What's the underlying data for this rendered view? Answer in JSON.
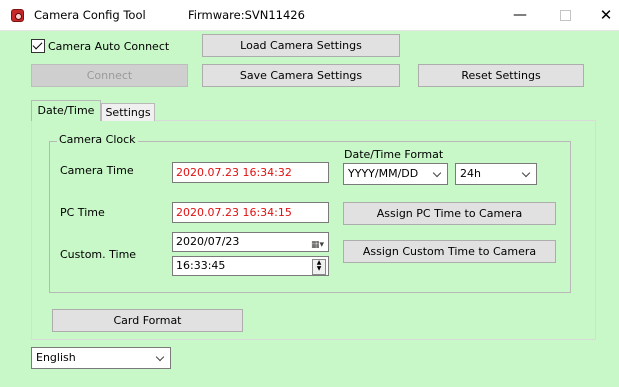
{
  "window": {
    "title": "Camera Config Tool",
    "firmware": "Firmware:SVN11426",
    "minimize": "—",
    "close": "✕"
  },
  "top": {
    "auto_connect_label": "Camera Auto Connect",
    "auto_connect_checked": true,
    "connect": "Connect",
    "load": "Load Camera Settings",
    "save": "Save Camera Settings",
    "reset": "Reset Settings"
  },
  "tabs": [
    "Date/Time",
    "Settings"
  ],
  "clock": {
    "group_title": "Camera Clock",
    "camera_time_label": "Camera Time",
    "camera_time_value": "2020.07.23 16:34:32",
    "pc_time_label": "PC Time",
    "pc_time_value": "2020.07.23 16:34:15",
    "custom_time_label": "Custom. Time",
    "custom_date_value": "2020/07/23",
    "custom_time_value": "16:33:45",
    "format_label": "Date/Time Format",
    "date_format_value": "YYYY/MM/DD",
    "hour_format_value": "24h",
    "assign_pc": "Assign PC Time to Camera",
    "assign_custom": "Assign Custom Time to Camera"
  },
  "card_format": "Card Format",
  "language": "English",
  "colors": {
    "background": "#c8f7c8",
    "time_text": "#e01010"
  }
}
